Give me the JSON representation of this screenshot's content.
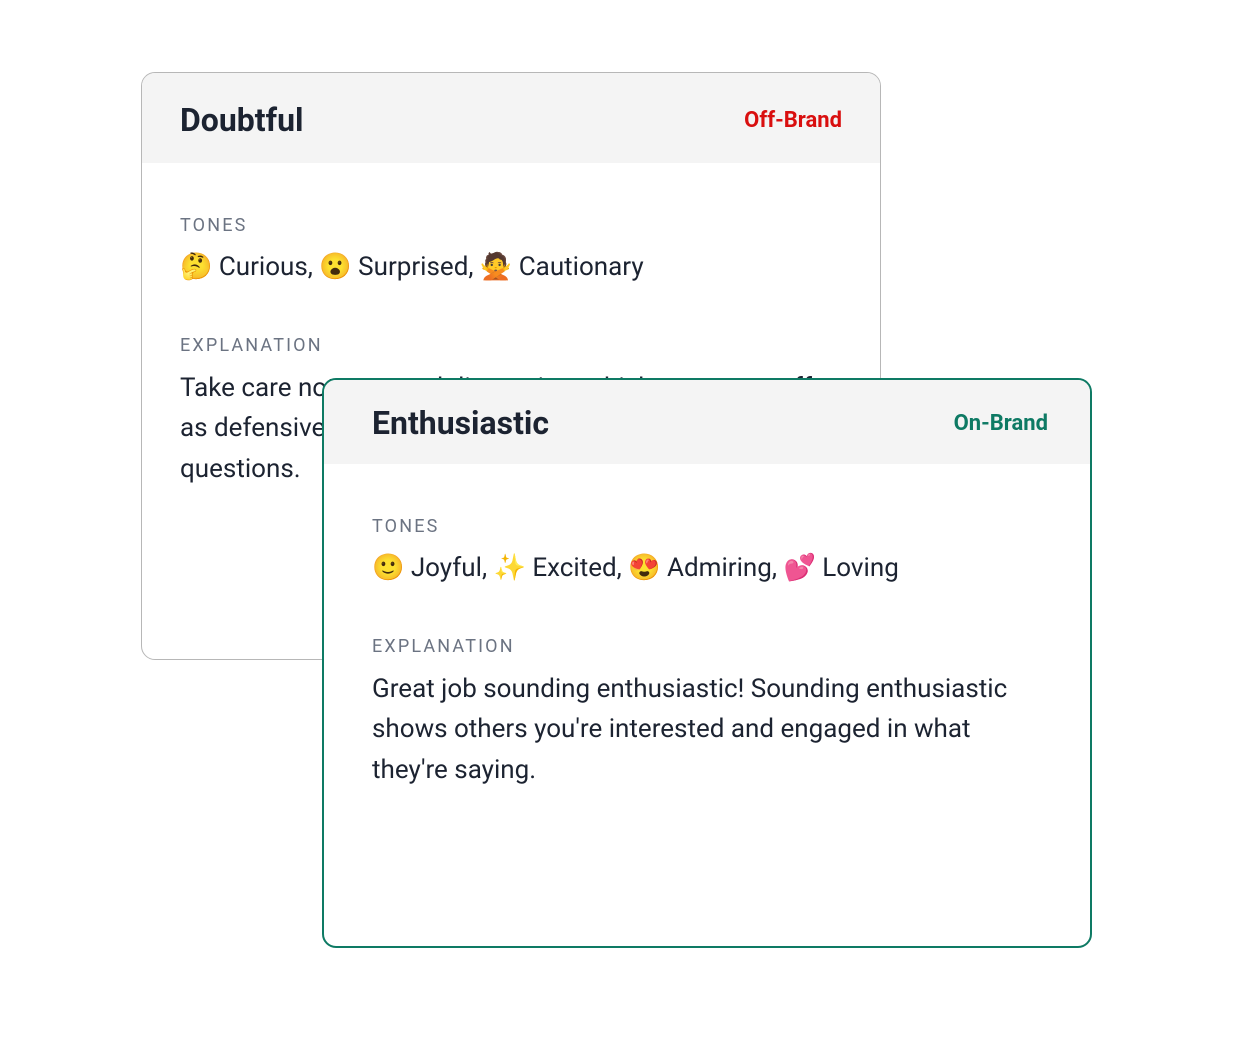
{
  "cards": [
    {
      "title": "Doubtful",
      "brand_label": "Off-Brand",
      "tones_label": "TONES",
      "tones_text": "🤔 Curious,  😮 Surprised,  🙅 Cautionary",
      "explanation_label": "EXPLANATION",
      "explanation_text": "Take care not to sound distrusting, which can come off as defensive. Avoid qualifying words and rhetorical questions."
    },
    {
      "title": "Enthusiastic",
      "brand_label": "On-Brand",
      "tones_label": "TONES",
      "tones_text": "🙂 Joyful,  ✨ Excited,  😍 Admiring,  💕 Loving",
      "explanation_label": "EXPLANATION",
      "explanation_text": "Great job sounding enthusiastic! Sounding enthusiastic shows others you're interested and engaged in what they're saying."
    }
  ]
}
